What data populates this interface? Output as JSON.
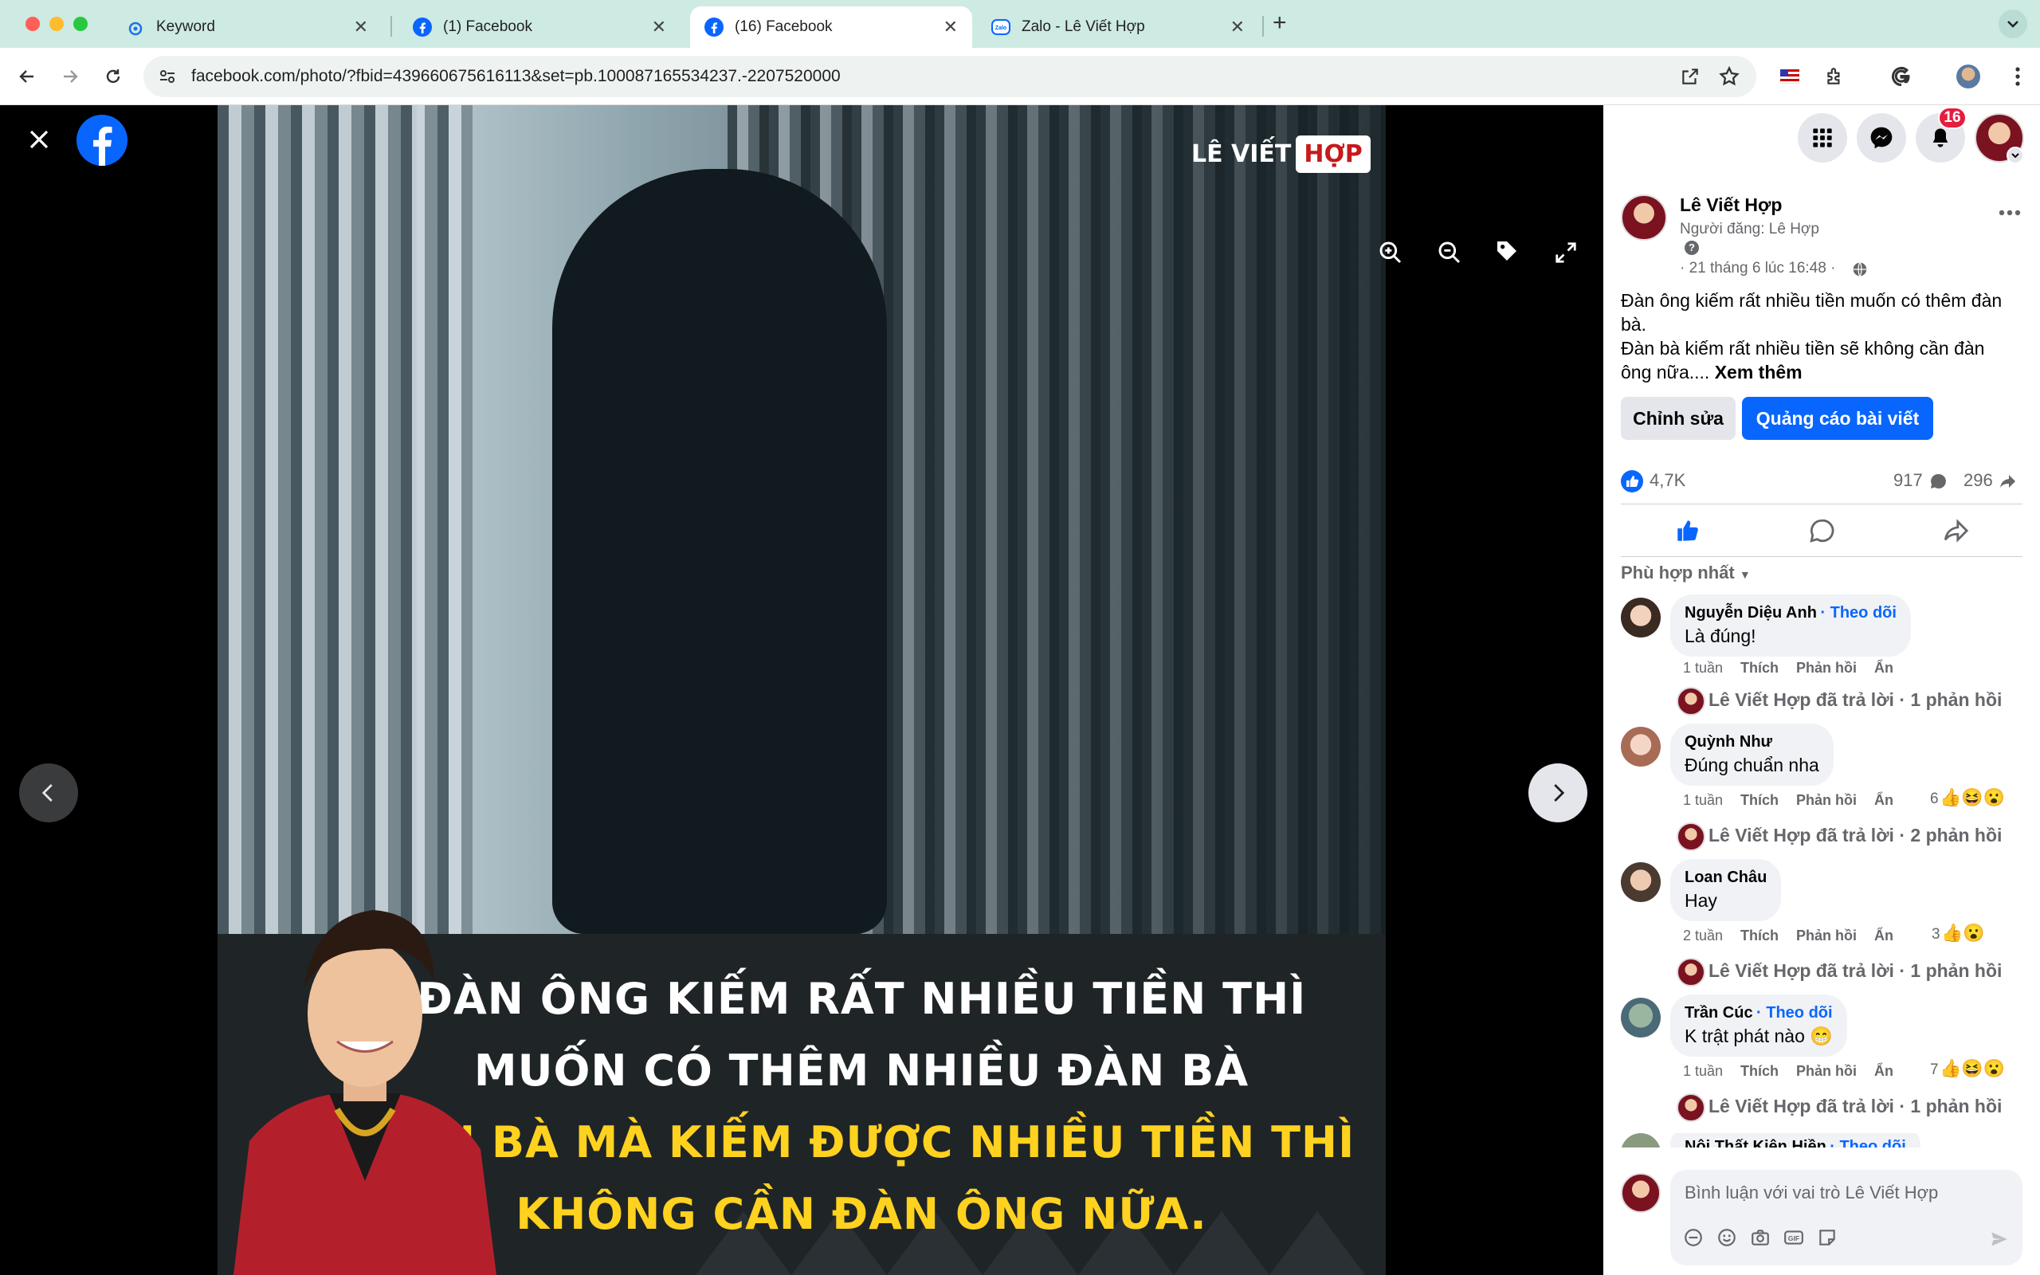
{
  "browser": {
    "tabs": [
      {
        "title": "Keyword",
        "active": false
      },
      {
        "title": "(1) Facebook",
        "active": false
      },
      {
        "title": "(16) Facebook",
        "active": true
      },
      {
        "title": "Zalo - Lê Viết Hợp",
        "active": false
      }
    ],
    "url": "facebook.com/photo/?fbid=439660675616113&set=pb.100087165534237.-2207520000"
  },
  "photo": {
    "brand_part1": "LÊ VIẾT",
    "brand_part2": "HỢP",
    "caption_lines": [
      {
        "text": "ĐÀN ÔNG KIẾM RẤT NHIỀU TIỀN THÌ",
        "color": "#ffffff"
      },
      {
        "text": "MUỐN CÓ THÊM NHIỀU ĐÀN BÀ",
        "color": "#ffffff"
      },
      {
        "text": "ĐÀN BÀ MÀ KIẾM ĐƯỢC NHIỀU TIỀN THÌ",
        "color": "#ffd21f"
      },
      {
        "text": "KHÔNG CẦN ĐÀN ÔNG NỮA.",
        "color": "#ffd21f"
      }
    ]
  },
  "header": {
    "notification_count": "16"
  },
  "post": {
    "author": "Lê Viết Hợp",
    "posted_by": "Người đăng: Lê Hợp",
    "help": "?",
    "date": "· 21 tháng 6 lúc 16:48 ·",
    "text_line1": "Đàn ông kiếm rất nhiều tiền muốn có thêm đàn",
    "text_line2": "bà.",
    "text_line3": "Đàn bà kiếm rất nhiều tiền sẽ không cần đàn",
    "text_line4": "ông nữa....",
    "see_more": "Xem thêm",
    "edit_label": "Chỉnh sửa",
    "boost_label": "Quảng cáo bài viết",
    "reactions": "4,7K",
    "comments_count": "917",
    "shares_count": "296",
    "sort_label": "Phù hợp nhất"
  },
  "comments": [
    {
      "name": "Nguyễn Diệu Anh",
      "follow": "· Theo dõi",
      "text": "Là đúng!",
      "time": "1 tuần",
      "like": "Thích",
      "reply": "Phản hồi",
      "hide": "Ẩn",
      "react_count": "",
      "replies": "Lê Viết Hợp đã trả lời · 1 phản hồi"
    },
    {
      "name": "Quỳnh Như",
      "follow": "",
      "text": "Đúng chuẩn nha",
      "time": "1 tuần",
      "like": "Thích",
      "reply": "Phản hồi",
      "hide": "Ẩn",
      "react_count": "6",
      "replies": "Lê Viết Hợp đã trả lời · 2 phản hồi"
    },
    {
      "name": "Loan Châu",
      "follow": "",
      "text": "Hay",
      "time": "2 tuần",
      "like": "Thích",
      "reply": "Phản hồi",
      "hide": "Ẩn",
      "react_count": "3",
      "replies": "Lê Viết Hợp đã trả lời · 1 phản hồi"
    },
    {
      "name": "Trần Cúc",
      "follow": "· Theo dõi",
      "text": "K trật phát nào 😁",
      "time": "1 tuần",
      "like": "Thích",
      "reply": "Phản hồi",
      "hide": "Ẩn",
      "react_count": "7",
      "replies": "Lê Viết Hợp đã trả lời · 1 phản hồi"
    },
    {
      "name": "Nội Thất Kiên Hiền",
      "follow": "· Theo dõi"
    }
  ],
  "composer": {
    "placeholder": "Bình luận với vai trò Lê Viết Hợp"
  },
  "colors": {
    "fb_blue": "#0866ff",
    "tab_bar": "#cdeae3",
    "caption_yellow": "#ffd21f"
  }
}
